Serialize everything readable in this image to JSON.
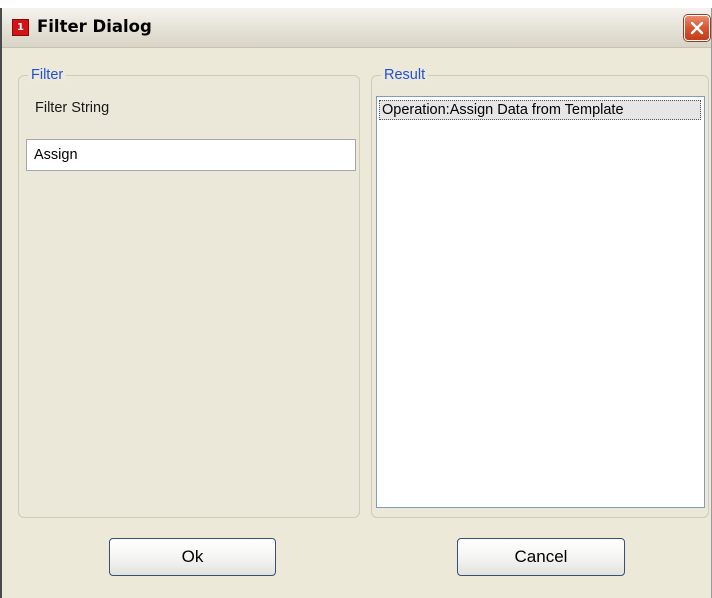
{
  "window": {
    "title": "Filter Dialog",
    "app_icon_glyph": "1",
    "app_icon_name": "app-icon",
    "close_icon_name": "close-icon"
  },
  "filter_group": {
    "legend": "Filter",
    "field_label": "Filter String",
    "input_value": "Assign"
  },
  "result_group": {
    "legend": "Result",
    "items": [
      "Operation:Assign Data from Template"
    ]
  },
  "buttons": {
    "ok_label": "Ok",
    "cancel_label": "Cancel"
  },
  "colors": {
    "legend_text": "#2250d8",
    "dialog_background": "#ece9d8",
    "close_button": "#d8552f",
    "app_icon": "#d41414"
  }
}
